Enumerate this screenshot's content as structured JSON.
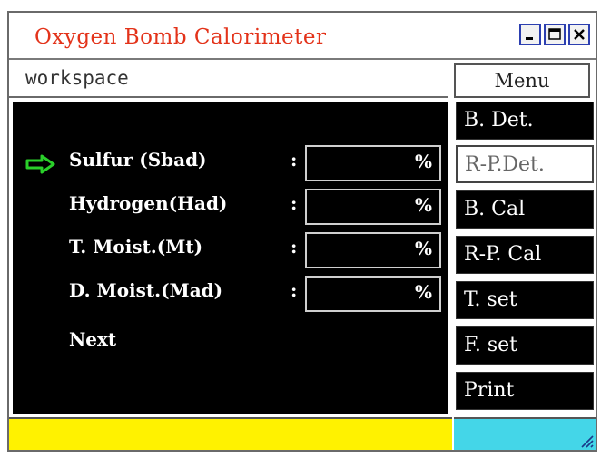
{
  "window": {
    "title": "Oxygen Bomb Calorimeter",
    "controls": [
      "minimize-icon",
      "maximize-icon",
      "close-icon"
    ],
    "title_color": "#e3331a"
  },
  "workspace": {
    "label": "workspace"
  },
  "menu": {
    "header": "Menu",
    "items": [
      {
        "label": "B. Det.",
        "active": false
      },
      {
        "label": "R-P.Det.",
        "active": true
      },
      {
        "label": "B. Cal",
        "active": false
      },
      {
        "label": "R-P. Cal",
        "active": false
      },
      {
        "label": "T. set",
        "active": false
      },
      {
        "label": "F. set",
        "active": false
      },
      {
        "label": "Print",
        "active": false
      }
    ]
  },
  "fields": [
    {
      "label": "Sulfur (Sbad)",
      "colon": ":",
      "value": "",
      "unit": "%",
      "selected": true
    },
    {
      "label": "Hydrogen(Had)",
      "colon": ":",
      "value": "",
      "unit": "%",
      "selected": false
    },
    {
      "label": "T. Moist.(Mt)",
      "colon": ":",
      "value": "",
      "unit": "%",
      "selected": false
    },
    {
      "label": "D. Moist.(Mad)",
      "colon": ":",
      "value": "",
      "unit": "%",
      "selected": false
    }
  ],
  "next": {
    "label": "Next"
  },
  "selector_icon": "arrow-right-icon",
  "colors": {
    "selector": "#2ad02a",
    "status_left": "#fff200",
    "status_right": "#44d6e8"
  }
}
